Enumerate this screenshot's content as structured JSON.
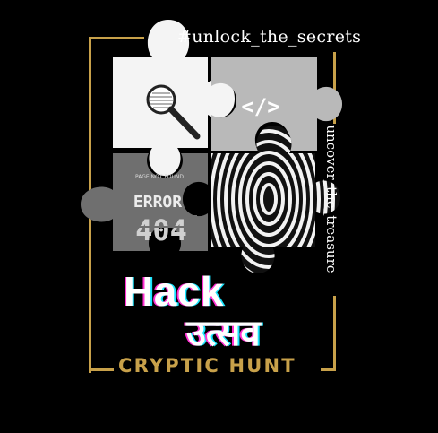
{
  "hashtag": "#unlock_the_secrets",
  "vertical_tag": "uncover_the_treasure",
  "title_latin": "Hack",
  "title_devanagari": "उत्सव",
  "subtitle": "CRYPTIC HUNT",
  "code_icon": "</>",
  "error_label": "ERROR",
  "error_code": "404",
  "error_small": "PAGE NOT FOUND",
  "colors": {
    "background": "#000000",
    "frame": "#c8a14a",
    "glitch_pink": "#ff2fd2",
    "glitch_cyan": "#19e6ff"
  },
  "icons": [
    "magnifying-glass-icon",
    "code-icon",
    "fingerprint-icon"
  ]
}
